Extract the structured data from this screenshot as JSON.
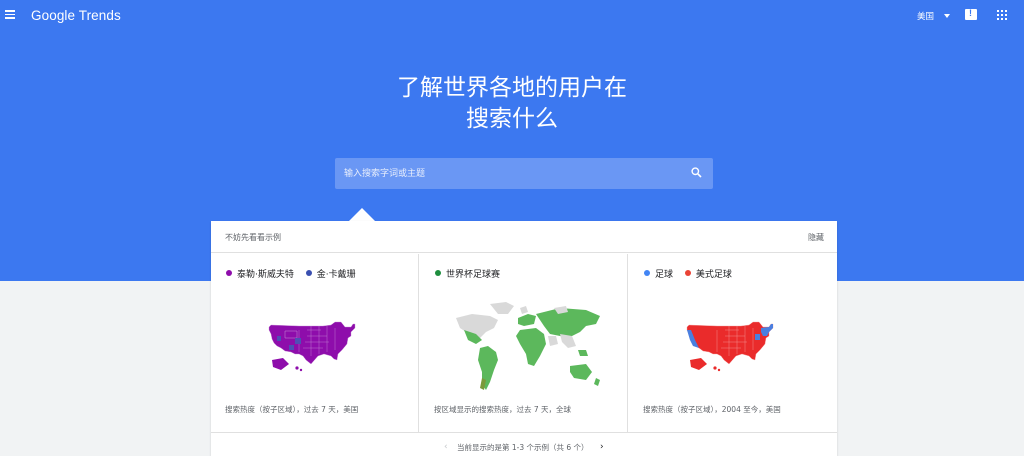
{
  "header": {
    "logo": "Google Trends",
    "country": "美国"
  },
  "hero": {
    "headline_line1": "了解世界各地的用户在",
    "headline_line2": "搜索什么"
  },
  "search": {
    "placeholder": "输入搜索字词或主题"
  },
  "examples": {
    "title": "不妨先看看示例",
    "hide_label": "隐藏",
    "cards": [
      {
        "legend": [
          {
            "label": "泰勒·斯威夫特",
            "color": "#8e0dab"
          },
          {
            "label": "金·卡戴珊",
            "color": "#3a4fb0"
          }
        ],
        "caption": "搜索热度（按子区域），过去 7 天，美国"
      },
      {
        "legend": [
          {
            "label": "世界杯足球赛",
            "color": "#1e8e3e"
          }
        ],
        "caption": "按区域显示的搜索热度，过去 7 天，全球"
      },
      {
        "legend": [
          {
            "label": "足球",
            "color": "#4285f4"
          },
          {
            "label": "美式足球",
            "color": "#ea4335"
          }
        ],
        "caption": "搜索热度（按子区域），2004 至今，美国"
      }
    ],
    "pager_text": "当前显示的是第 1-3 个示例（共 6 个）"
  },
  "colors": {
    "hero_background": "#3c78f0",
    "map_purple": "#8e0dab",
    "map_blue_purple": "#4f4fb5",
    "map_green": "#5cb85c",
    "map_gray": "#d9d9d9",
    "map_red": "#ea2b2b",
    "map_blue": "#4a7fe0"
  }
}
